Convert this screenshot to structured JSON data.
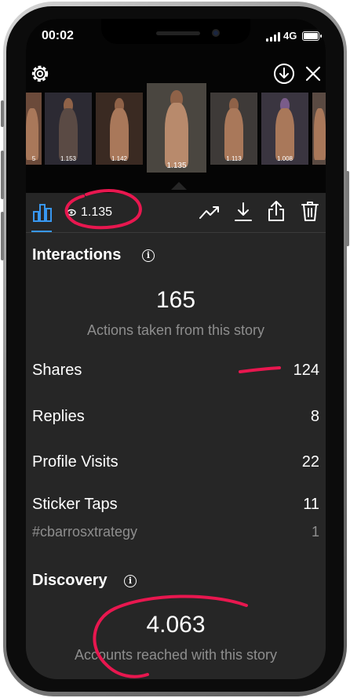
{
  "status_bar": {
    "time": "00:02",
    "network": "4G"
  },
  "top_bar": {
    "settings_icon": "gear-icon",
    "download_icon": "download-circle-icon",
    "close_icon": "close-icon"
  },
  "thumbnails": [
    {
      "views": "5"
    },
    {
      "views": "1.153"
    },
    {
      "views": "1.142"
    },
    {
      "views": "1.135",
      "selected": true
    },
    {
      "views": "1.113"
    },
    {
      "views": "1.008"
    },
    {
      "views": ""
    }
  ],
  "toolbar": {
    "views": "1.135",
    "icons": [
      "bar-chart-icon",
      "eye-icon",
      "trending-icon",
      "download-icon",
      "share-icon",
      "trash-icon"
    ]
  },
  "interactions": {
    "title": "Interactions",
    "total": "165",
    "subtitle": "Actions taken from this story",
    "rows": [
      {
        "label": "Shares",
        "value": "124"
      },
      {
        "label": "Replies",
        "value": "8"
      },
      {
        "label": "Profile Visits",
        "value": "22"
      },
      {
        "label": "Sticker Taps",
        "value": "11"
      },
      {
        "label": "#cbarrosxtrategy",
        "value": "1"
      }
    ]
  },
  "discovery": {
    "title": "Discovery",
    "total": "4.063",
    "subtitle": "Accounts reached with this story"
  },
  "colors": {
    "accent": "#3897f0",
    "annotation": "#e8174f",
    "background": "#262626"
  }
}
